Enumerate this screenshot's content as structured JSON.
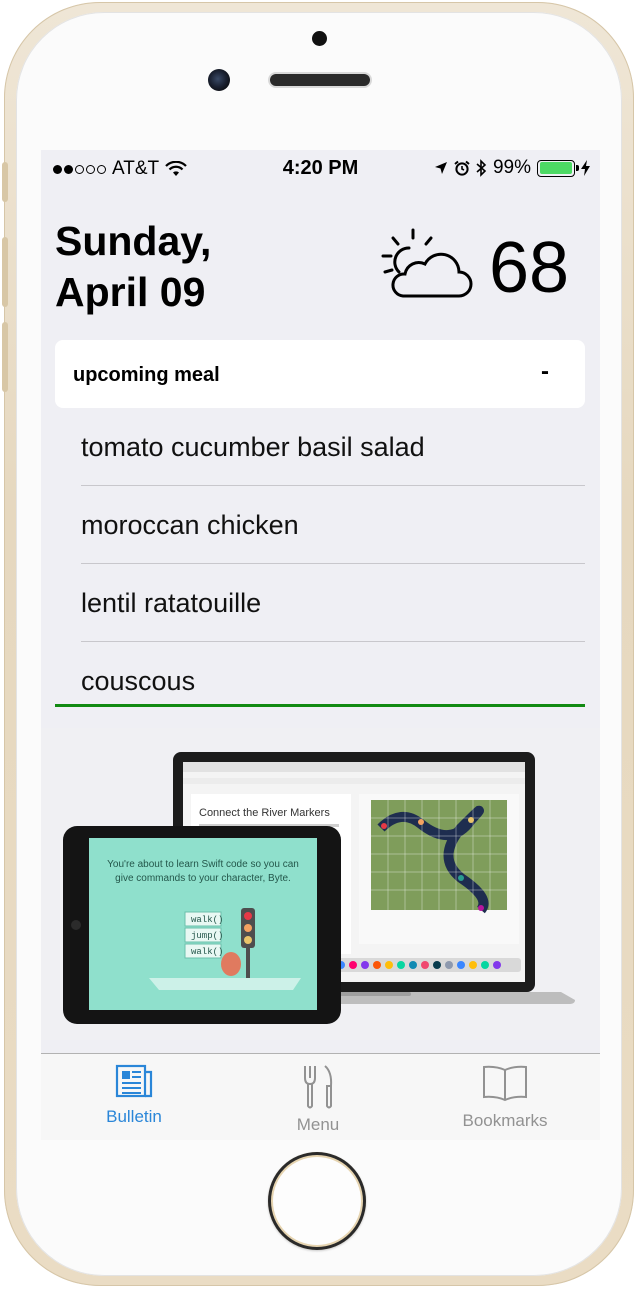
{
  "status_bar": {
    "carrier": "AT&T",
    "time": "4:20 PM",
    "battery_percent": "99%",
    "battery_level": 0.99,
    "signal_bars_filled": 2,
    "signal_bars_total": 5
  },
  "header": {
    "date_line1": "Sunday,",
    "date_line2": "April 09",
    "weather_icon": "partly-cloudy-icon",
    "temperature": "68"
  },
  "meal": {
    "title": "upcoming meal",
    "toggle": "-",
    "items": [
      "tomato cucumber basil salad",
      "moroccan chicken",
      "lentil ratatouille",
      "couscous"
    ]
  },
  "promo": {
    "laptop_heading": "Connect the River Markers",
    "tablet_text": "You're about to learn Swift code so you can give commands to your character, Byte.",
    "code_lines": [
      "walk()",
      "jump()",
      "walk()"
    ]
  },
  "tab_bar": {
    "tabs": [
      {
        "label": "Bulletin",
        "icon": "newspaper-icon",
        "active": true
      },
      {
        "label": "Menu",
        "icon": "fork-knife-icon",
        "active": false
      },
      {
        "label": "Bookmarks",
        "icon": "book-icon",
        "active": false
      }
    ]
  },
  "colors": {
    "accent": "#2a86d8",
    "rule": "#128a12",
    "battery": "#4cd964",
    "background": "#efeff4"
  }
}
